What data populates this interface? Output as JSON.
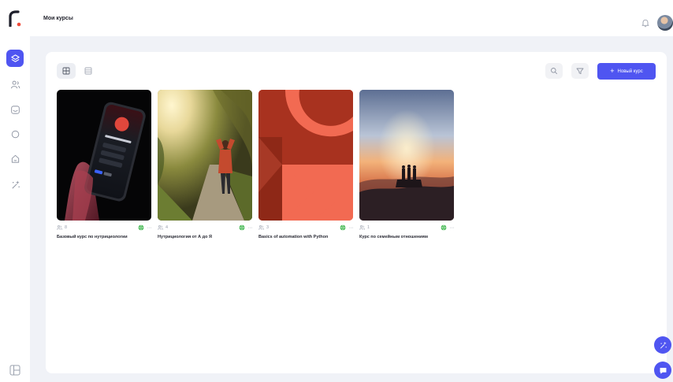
{
  "header": {
    "title": "Мои курсы"
  },
  "sidebar": {
    "items": [
      {
        "icon": "stack-icon",
        "active": true
      },
      {
        "icon": "users-icon",
        "active": false
      },
      {
        "icon": "card-icon",
        "active": false
      },
      {
        "icon": "chat-icon",
        "active": false
      },
      {
        "icon": "home-icon",
        "active": false
      },
      {
        "icon": "magic-icon",
        "active": false
      }
    ],
    "bottom_icon": "layout-icon"
  },
  "toolbar": {
    "new_course_label": "Новый курс",
    "new_course_plus": "+"
  },
  "courses": [
    {
      "title": "Базовый курс по нутрициологии",
      "students": "8"
    },
    {
      "title": "Нутрициология от А до Я",
      "students": "4"
    },
    {
      "title": "Basics of automation with Python",
      "students": "3"
    },
    {
      "title": "Курс по семейным отношениям",
      "students": "1"
    }
  ],
  "colors": {
    "accent": "#4f55f1",
    "published": "#3bb54a",
    "background": "#f0f2f7"
  }
}
